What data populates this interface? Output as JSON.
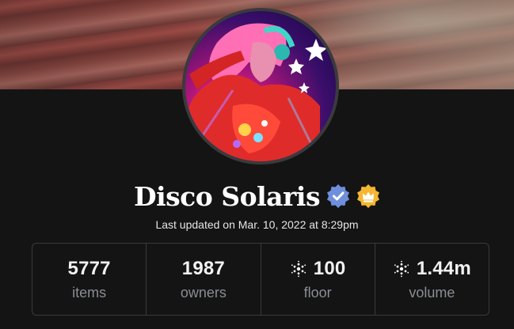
{
  "collection": {
    "name": "Disco Solaris",
    "last_updated": "Last updated on Mar. 10, 2022 at 8:29pm",
    "verified_badge_icon": "verified-check-icon",
    "royalty_badge_icon": "crown-badge-icon"
  },
  "stats": [
    {
      "value": "5777",
      "label": "items",
      "icon": null
    },
    {
      "value": "1987",
      "label": "owners",
      "icon": null
    },
    {
      "value": "100",
      "label": "floor",
      "icon": "cardano-ada-icon"
    },
    {
      "value": "1.44m",
      "label": "volume",
      "icon": "cardano-ada-icon"
    }
  ],
  "colors": {
    "background": "#141414",
    "verified_badge": "#6f8fdc",
    "crown_badge": "#f5b731",
    "label_gray": "#8a8d93",
    "border": "#3a3a3e"
  }
}
